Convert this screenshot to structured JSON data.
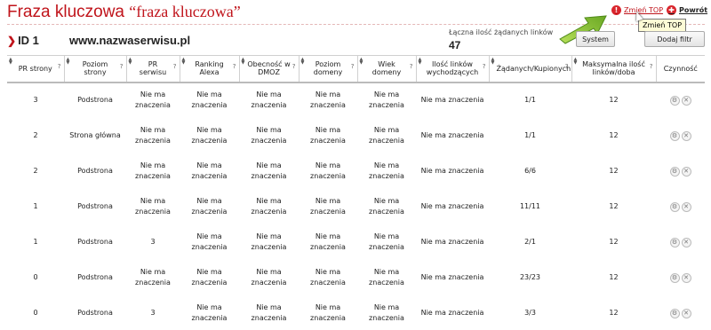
{
  "page": {
    "title": "Fraza kluczowa",
    "keyword": "“fraza kluczowa”",
    "id_label": "ID 1",
    "site": "www.nazwaserwisu.pl"
  },
  "top_links": {
    "change_top": "Zmień TOP",
    "back": "Powrót"
  },
  "tooltip": "Zmień TOP",
  "summary": {
    "label": "Łączna ilość żądanych linków",
    "value": "47"
  },
  "buttons": {
    "system": "System",
    "filter": "Dodaj filtr"
  },
  "columns": [
    "PR strony",
    "Poziom strony",
    "PR serwisu",
    "Ranking Alexa",
    "Obecność w DMOZ",
    "Poziom domeny",
    "Wiek domeny",
    "Ilość linków wychodzących",
    "Żądanych/Kupionych",
    "Maksymalna ilość linków/doba",
    "Czynność"
  ],
  "rows": [
    {
      "pr": "3",
      "poziom": "Podstrona",
      "prs": "Nie ma znaczenia",
      "alexa": "Nie ma znaczenia",
      "dmoz": "Nie ma znaczenia",
      "pdom": "Nie ma znaczenia",
      "wiek": "Nie ma znaczenia",
      "ilosc": "Nie ma znaczenia",
      "zk": "1/1",
      "max": "12"
    },
    {
      "pr": "2",
      "poziom": "Strona główna",
      "prs": "Nie ma znaczenia",
      "alexa": "Nie ma znaczenia",
      "dmoz": "Nie ma znaczenia",
      "pdom": "Nie ma znaczenia",
      "wiek": "Nie ma znaczenia",
      "ilosc": "Nie ma znaczenia",
      "zk": "1/1",
      "max": "12"
    },
    {
      "pr": "2",
      "poziom": "Podstrona",
      "prs": "Nie ma znaczenia",
      "alexa": "Nie ma znaczenia",
      "dmoz": "Nie ma znaczenia",
      "pdom": "Nie ma znaczenia",
      "wiek": "Nie ma znaczenia",
      "ilosc": "Nie ma znaczenia",
      "zk": "6/6",
      "max": "12"
    },
    {
      "pr": "1",
      "poziom": "Podstrona",
      "prs": "Nie ma znaczenia",
      "alexa": "Nie ma znaczenia",
      "dmoz": "Nie ma znaczenia",
      "pdom": "Nie ma znaczenia",
      "wiek": "Nie ma znaczenia",
      "ilosc": "Nie ma znaczenia",
      "zk": "11/11",
      "max": "12"
    },
    {
      "pr": "1",
      "poziom": "Podstrona",
      "prs": "3",
      "alexa": "Nie ma znaczenia",
      "dmoz": "Nie ma znaczenia",
      "pdom": "Nie ma znaczenia",
      "wiek": "Nie ma znaczenia",
      "ilosc": "Nie ma znaczenia",
      "zk": "2/1",
      "max": "12"
    },
    {
      "pr": "0",
      "poziom": "Podstrona",
      "prs": "Nie ma znaczenia",
      "alexa": "Nie ma znaczenia",
      "dmoz": "Nie ma znaczenia",
      "pdom": "Nie ma znaczenia",
      "wiek": "Nie ma znaczenia",
      "ilosc": "Nie ma znaczenia",
      "zk": "23/23",
      "max": "12"
    },
    {
      "pr": "0",
      "poziom": "Podstrona",
      "prs": "3",
      "alexa": "Nie ma znaczenia",
      "dmoz": "Nie ma znaczenia",
      "pdom": "Nie ma znaczenia",
      "wiek": "Nie ma znaczenia",
      "ilosc": "Nie ma znaczenia",
      "zk": "3/3",
      "max": "12"
    }
  ],
  "icons": {
    "settings": "gear-icon",
    "delete": "close-icon",
    "alert": "alert-circle-icon",
    "back": "back-circle-icon"
  },
  "colors": {
    "accent": "#c0141b",
    "arrow": "#8cc63f"
  }
}
